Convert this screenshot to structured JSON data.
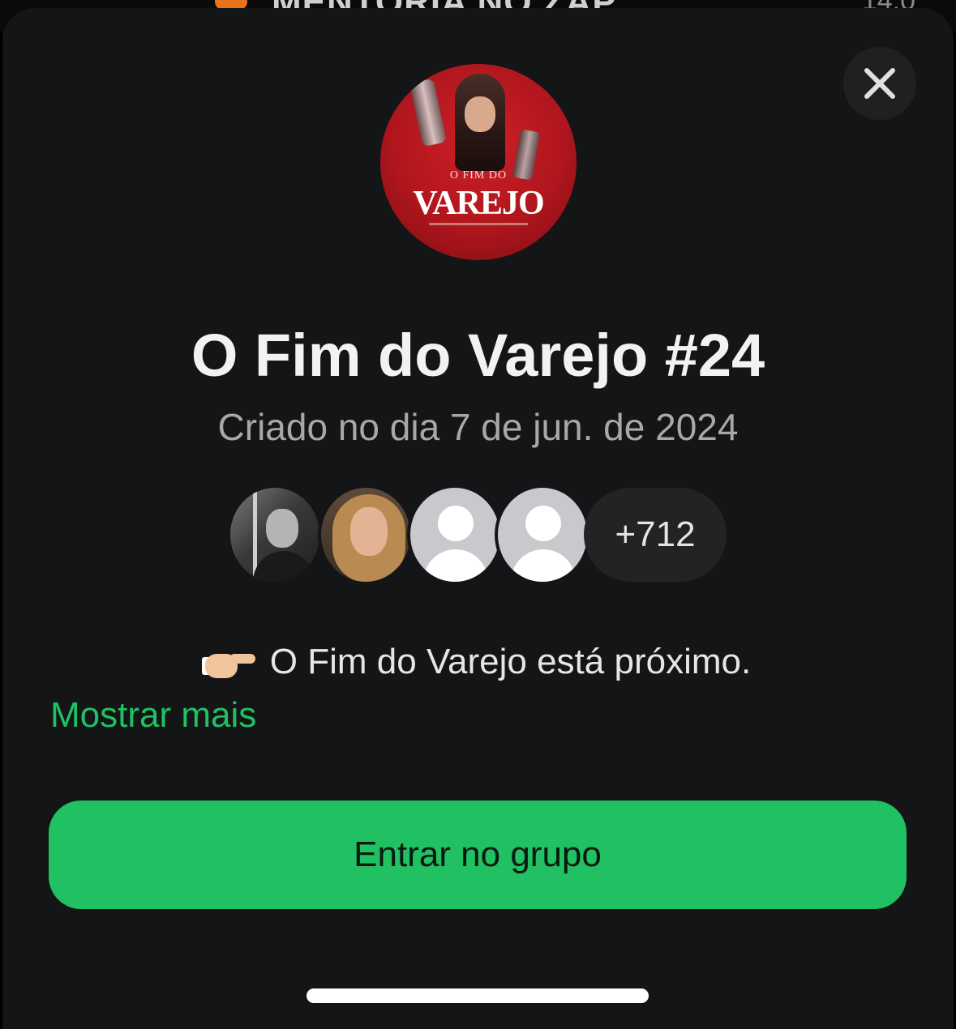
{
  "background": {
    "title_partial": "MENTORIA NO ZAP",
    "time_partial": "14:0"
  },
  "group": {
    "photo_caption_small": "O FIM DO",
    "photo_caption_big": "VAREJO",
    "title": "O Fim do Varejo #24",
    "created": "Criado no dia 7 de jun. de 2024",
    "member_extra_count": "+712",
    "description": "O Fim do Varejo está próximo.",
    "show_more_label": "Mostrar mais",
    "join_label": "Entrar no grupo"
  },
  "icons": {
    "close": "close-icon",
    "pointing": "backhand-index-pointing-right-icon"
  },
  "colors": {
    "sheet_bg": "#141516",
    "accent_green": "#21c063",
    "title_text": "#f2f2f2",
    "secondary_text": "#a8a8a8"
  }
}
